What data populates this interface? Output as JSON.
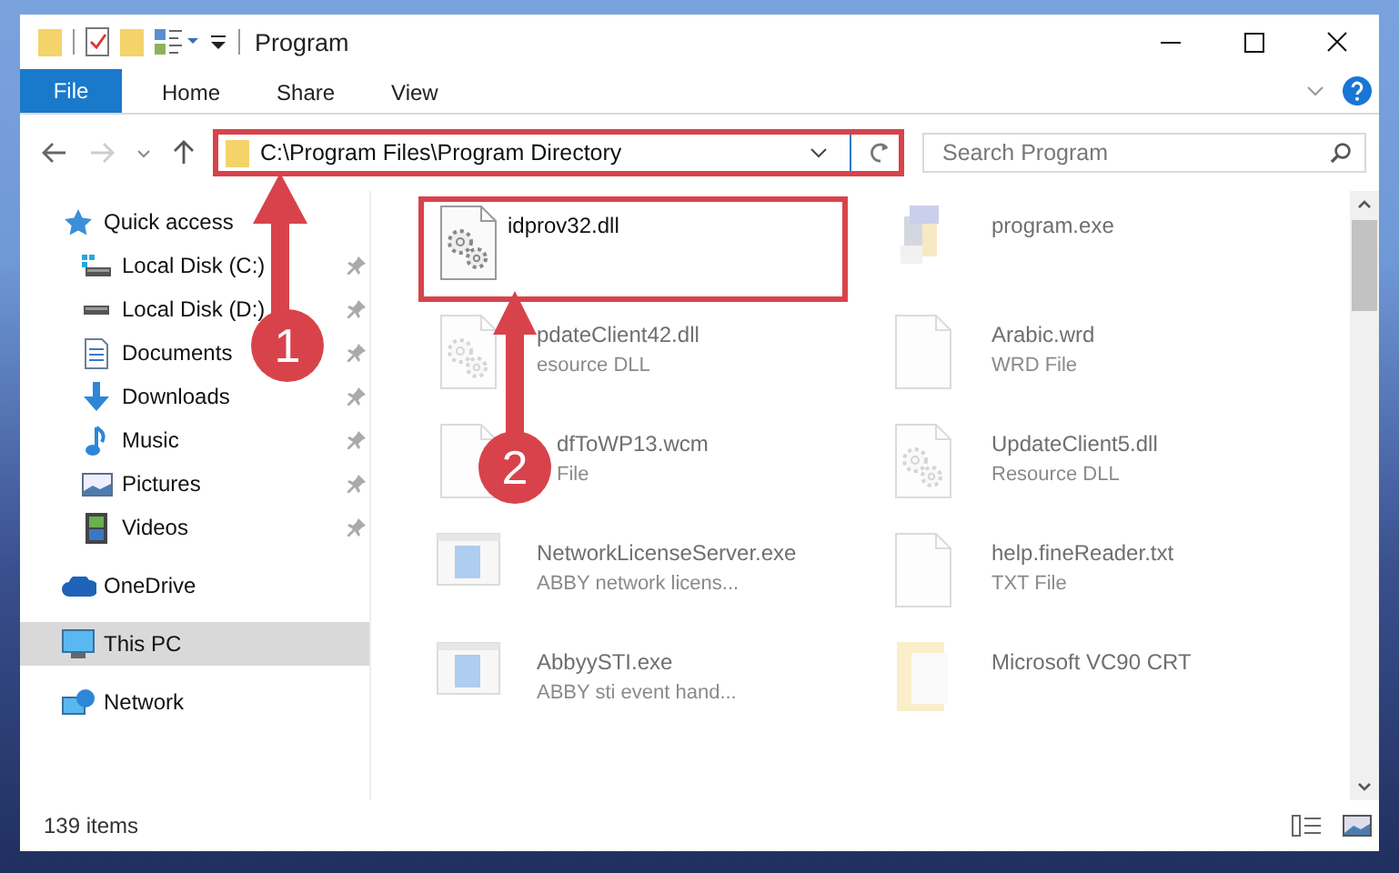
{
  "window": {
    "title": "Program"
  },
  "ribbon": {
    "file_button": "File",
    "tabs": [
      {
        "label": "Home",
        "selected": false
      },
      {
        "label": "Share",
        "selected": false
      },
      {
        "label": "View",
        "selected": false
      }
    ]
  },
  "address_bar": {
    "path": "C:\\Program Files\\Program Directory",
    "highlighted": true
  },
  "search": {
    "placeholder": "Search Program"
  },
  "navigation": {
    "items": [
      {
        "label": "Quick access",
        "kind": "star",
        "selected": false,
        "children": [
          {
            "label": "Local Disk (C:)",
            "kind": "system-drive",
            "pinned": true,
            "selected": false
          },
          {
            "label": "Local Disk (D:)",
            "kind": "drive",
            "pinned": true,
            "selected": false
          },
          {
            "label": "Documents",
            "kind": "documents",
            "pinned": true,
            "selected": false
          },
          {
            "label": "Downloads",
            "kind": "downloads",
            "pinned": true,
            "selected": false
          },
          {
            "label": "Music",
            "kind": "music",
            "pinned": true,
            "selected": false
          },
          {
            "label": "Pictures",
            "kind": "pictures",
            "pinned": true,
            "selected": false
          },
          {
            "label": "Videos",
            "kind": "videos",
            "pinned": true,
            "selected": false
          }
        ]
      },
      {
        "label": "OneDrive",
        "kind": "cloud",
        "selected": false
      },
      {
        "label": "This PC",
        "kind": "computer",
        "selected": true
      },
      {
        "label": "Network",
        "kind": "network",
        "selected": false
      }
    ]
  },
  "files": [
    {
      "name": "idprov32.dll",
      "kind": "dll",
      "highlighted": true,
      "faded": false
    },
    {
      "name": "program.exe",
      "kind": "app",
      "highlighted": false,
      "faded": true
    },
    {
      "name": "pdateClient42.dll",
      "type": "esource DLL",
      "kind": "dll",
      "highlighted": false,
      "faded": true
    },
    {
      "name": "Arabic.wrd",
      "type": "WRD File",
      "kind": "doc",
      "highlighted": false,
      "faded": true
    },
    {
      "name": "dfToWP13.wcm",
      "type": "File",
      "kind": "doc",
      "highlighted": false,
      "faded": true
    },
    {
      "name": "UpdateClient5.dll",
      "type": "Resource DLL",
      "kind": "dll",
      "highlighted": false,
      "faded": true
    },
    {
      "name": "NetworkLicenseServer.exe",
      "type": "ABBY network licens...",
      "kind": "exe",
      "highlighted": false,
      "faded": true
    },
    {
      "name": "help.fineReader.txt",
      "type": "TXT File",
      "kind": "doc",
      "highlighted": false,
      "faded": true
    },
    {
      "name": "AbbyySTI.exe",
      "type": "ABBY sti event hand...",
      "kind": "exe",
      "highlighted": false,
      "faded": true
    },
    {
      "name": "Microsoft VC90 CRT",
      "kind": "folder",
      "highlighted": false,
      "faded": true
    }
  ],
  "annotations": [
    {
      "label": "1"
    },
    {
      "label": "2"
    }
  ],
  "status_bar": {
    "item_count": "139 items"
  }
}
